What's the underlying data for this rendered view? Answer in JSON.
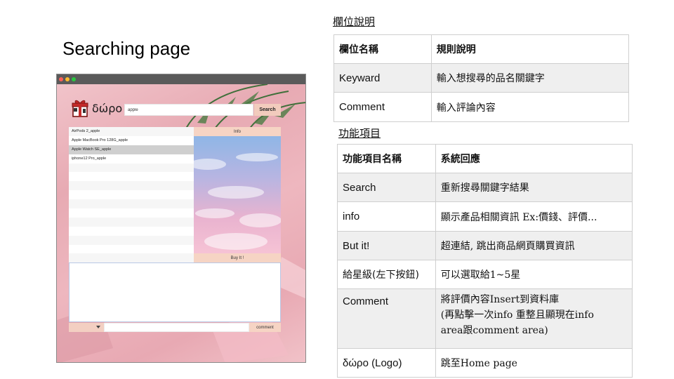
{
  "page_title": "Searching page",
  "app": {
    "logo_text": "δώρο",
    "search": {
      "value": "apple",
      "button_label": "Search"
    },
    "results": [
      "AirPods 2_apple",
      "Apple MacBook Pro 128G_apple",
      "Apple Watch SE_apple",
      "iphone12 Pro_apple",
      "",
      "",
      "",
      "",
      "",
      "",
      "",
      "",
      "",
      "",
      ""
    ],
    "selected_result_index": 2,
    "info_label": "Info",
    "buy_label": "Buy It !",
    "comment_button_label": "comment",
    "comment_text": "",
    "star_value": ""
  },
  "fields_section": {
    "label": "欄位說明",
    "headers": [
      "欄位名稱",
      "規則說明"
    ],
    "rows": [
      {
        "name": "Keyward",
        "desc": "輸入想搜尋的品名關鍵字"
      },
      {
        "name": "Comment",
        "desc": "輸入評論內容"
      }
    ]
  },
  "functions_section": {
    "label": "功能項目",
    "headers": [
      "功能項目名稱",
      "系統回應"
    ],
    "rows": [
      {
        "name": "Search",
        "desc": "重新搜尋關鍵字結果"
      },
      {
        "name": "info",
        "desc": "顯示產品相關資訊 Ex:價錢、評價..."
      },
      {
        "name": "But it!",
        "desc": "超連結, 跳出商品網頁購買資訊"
      },
      {
        "name": "給星級(左下按鈕)",
        "desc": "可以選取給1~5星"
      },
      {
        "name": "Comment",
        "desc_lines": [
          "將評價內容Insert到資料庫",
          "(再點擊一次info 重整且顯現在info",
          "area跟comment area)"
        ]
      },
      {
        "name": "δώρο (Logo)",
        "desc": "跳至Home page"
      }
    ]
  }
}
